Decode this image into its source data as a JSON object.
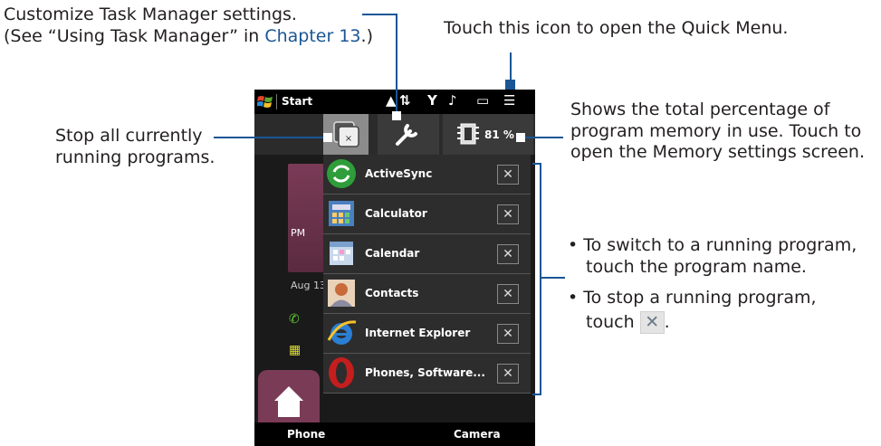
{
  "annotations": {
    "settings_line1": "Customize Task Manager settings.",
    "settings_line2_a": "(See “Using Task Manager” in ",
    "settings_line2_link": "Chapter 13",
    "settings_line2_b": ".)",
    "quick_menu": "Touch this icon to open the Quick Menu.",
    "stop_all_line1": "Stop all currently",
    "stop_all_line2": "running programs.",
    "memory_line1": "Shows the total percentage of",
    "memory_line2": "program memory in use. Touch to",
    "memory_line3": "open the Memory settings screen.",
    "bullet1_line1": "To switch to a running program,",
    "bullet1_line2": "touch the program name.",
    "bullet2_line1": "To stop a running program,",
    "bullet2_line2_a": "touch",
    "bullet2_line2_b": "."
  },
  "phone": {
    "start_label": "Start",
    "memory_percent": "81 %",
    "programs": [
      {
        "name": "ActiveSync",
        "icon": "activesync-icon",
        "color": "#2e9d3a"
      },
      {
        "name": "Calculator",
        "icon": "calculator-icon",
        "color": "#4a7fc0"
      },
      {
        "name": "Calendar",
        "icon": "calendar-icon",
        "color": "#c8d8ec"
      },
      {
        "name": "Contacts",
        "icon": "contacts-icon",
        "color": "#c86a3a"
      },
      {
        "name": "Internet Explorer",
        "icon": "internet-explorer-icon",
        "color": "#2a7fd4"
      },
      {
        "name": "Phones, Software...",
        "icon": "opera-icon",
        "color": "#c41e1e"
      }
    ],
    "close_glyph": "✕",
    "bg_pm": "PM",
    "bg_date": "Aug 13",
    "bottom_left": "Phone",
    "bottom_right": "Camera"
  }
}
